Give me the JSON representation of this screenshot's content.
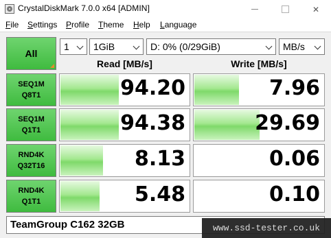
{
  "window": {
    "title": "CrystalDiskMark 7.0.0 x64 [ADMIN]"
  },
  "menu": [
    {
      "label": "File",
      "ul": "F",
      "rest": "ile"
    },
    {
      "label": "Settings",
      "ul": "S",
      "rest": "ettings"
    },
    {
      "label": "Profile",
      "ul": "P",
      "rest": "rofile"
    },
    {
      "label": "Theme",
      "ul": "T",
      "rest": "heme"
    },
    {
      "label": "Help",
      "ul": "H",
      "rest": "elp"
    },
    {
      "label": "Language",
      "ul": "L",
      "rest": "anguage"
    }
  ],
  "controls": {
    "all_label": "All",
    "count": "1",
    "size": "1GiB",
    "drive": "D: 0% (0/29GiB)",
    "unit": "MB/s"
  },
  "headers": {
    "read": "Read [MB/s]",
    "write": "Write [MB/s]"
  },
  "tests": [
    {
      "line1": "SEQ1M",
      "line2": "Q8T1",
      "read": "94.20",
      "write": "7.96",
      "read_fill": 0.45,
      "write_fill": 0.34
    },
    {
      "line1": "SEQ1M",
      "line2": "Q1T1",
      "read": "94.38",
      "write": "29.69",
      "read_fill": 0.45,
      "write_fill": 0.5
    },
    {
      "line1": "RND4K",
      "line2": "Q32T16",
      "read": "8.13",
      "write": "0.06",
      "read_fill": 0.33,
      "write_fill": 0.0
    },
    {
      "line1": "RND4K",
      "line2": "Q1T1",
      "read": "5.48",
      "write": "0.10",
      "read_fill": 0.3,
      "write_fill": 0.0
    }
  ],
  "drive_label": "TeamGroup C162 32GB",
  "watermark": "www.ssd-tester.co.uk",
  "colors": {
    "button_green": "#3fbb3f",
    "bar_green": "#7fd96a",
    "accent_orange": "#e68a2e"
  }
}
